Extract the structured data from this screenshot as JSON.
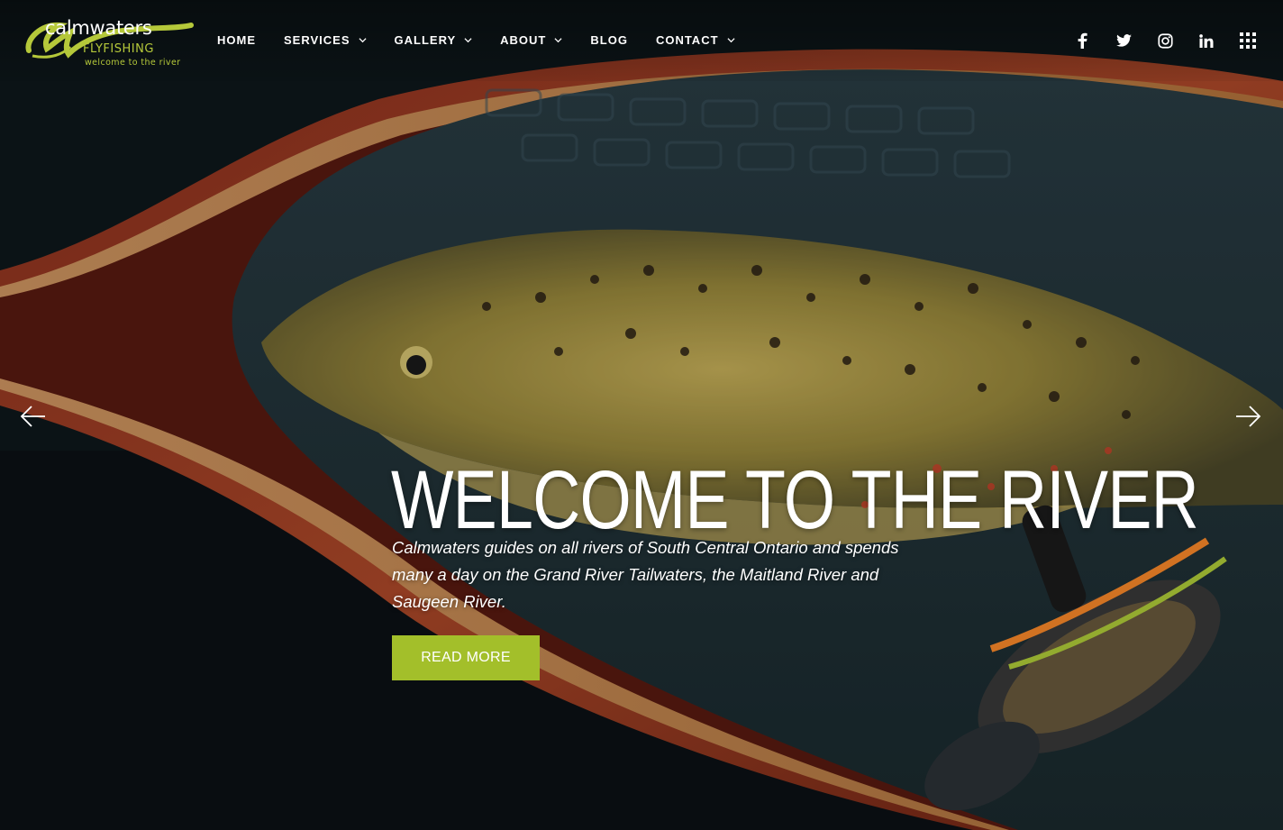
{
  "brand": {
    "name": "calmwaters",
    "subtitle": "FLYFISHING",
    "tagline": "welcome to the river",
    "accent_color": "#a3bf2a"
  },
  "nav": {
    "items": [
      {
        "label": "HOME",
        "has_dropdown": false
      },
      {
        "label": "SERVICES",
        "has_dropdown": true
      },
      {
        "label": "GALLERY",
        "has_dropdown": true
      },
      {
        "label": "ABOUT",
        "has_dropdown": true
      },
      {
        "label": "BLOG",
        "has_dropdown": false
      },
      {
        "label": "CONTACT",
        "has_dropdown": true
      }
    ]
  },
  "social": {
    "icons": [
      "facebook-icon",
      "twitter-icon",
      "instagram-icon",
      "linkedin-icon",
      "apps-grid-icon"
    ]
  },
  "hero": {
    "headline": "WELCOME TO THE RIVER",
    "lead": "Calmwaters guides on all rivers of South Central Ontario and spends many a day on the Grand River Tailwaters, the Maitland River and Saugeen River.",
    "cta_label": "READ MORE",
    "prev_icon": "arrow-left-icon",
    "next_icon": "arrow-right-icon"
  }
}
